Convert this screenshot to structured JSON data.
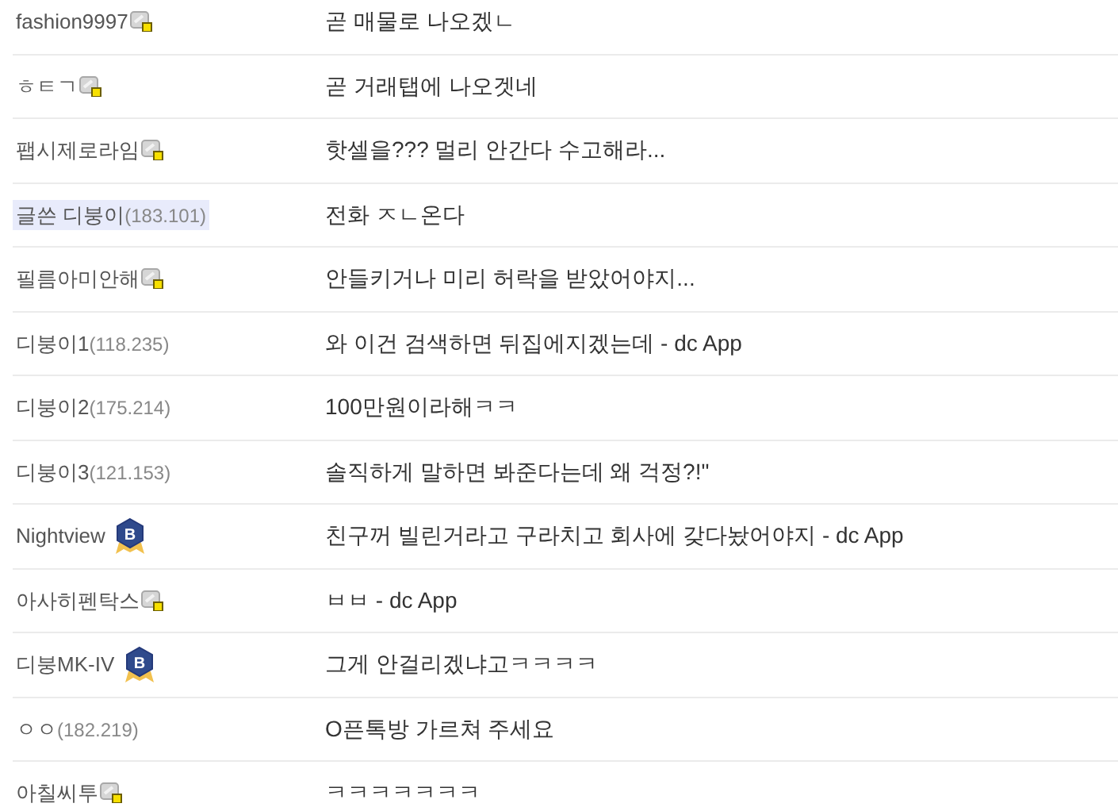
{
  "comments": [
    {
      "writer": {
        "name": "fashion9997",
        "kind": "fixed"
      },
      "author": false,
      "text": "곧 매물로 나오겠ㄴ"
    },
    {
      "writer": {
        "name": "ㅎㅌㄱ",
        "kind": "fixed"
      },
      "author": false,
      "text": "곧 거래탭에 나오겟네"
    },
    {
      "writer": {
        "name": "팹시제로라임",
        "kind": "fixed"
      },
      "author": false,
      "text": "핫셀을??? 멀리 안간다 수고해라..."
    },
    {
      "writer": {
        "name": "글쓴 디붕이",
        "kind": "guest",
        "ip": "(183.101)"
      },
      "author": true,
      "text": "전화 ㅈㄴ온다"
    },
    {
      "writer": {
        "name": "필름아미안해",
        "kind": "fixed"
      },
      "author": false,
      "text": "안들키거나 미리 허락을 받았어야지..."
    },
    {
      "writer": {
        "name": "디붕이1",
        "kind": "guest",
        "ip": "(118.235)"
      },
      "author": false,
      "text": "와 이건 검색하면 뒤집에지겠는데 - dc App"
    },
    {
      "writer": {
        "name": "디붕이2",
        "kind": "guest",
        "ip": "(175.214)"
      },
      "author": false,
      "text": "100만원이라해ㅋㅋ"
    },
    {
      "writer": {
        "name": "디붕이3",
        "kind": "guest",
        "ip": "(121.153)"
      },
      "author": false,
      "text": "솔직하게 말하면 봐준다는데 왜 걱정?!\""
    },
    {
      "writer": {
        "name": "Nightview",
        "kind": "badge",
        "badge": "B"
      },
      "author": false,
      "text": "친구꺼 빌린거라고 구라치고 회사에 갖다놨어야지 - dc App"
    },
    {
      "writer": {
        "name": "아사히펜탁스",
        "kind": "fixed"
      },
      "author": false,
      "text": "ㅂㅂ - dc App"
    },
    {
      "writer": {
        "name": "디붕MK-IV",
        "kind": "badge",
        "badge": "B"
      },
      "author": false,
      "text": "그게 안걸리겠냐고ㅋㅋㅋㅋ"
    },
    {
      "writer": {
        "name": "ㅇㅇ",
        "kind": "guest",
        "ip": "(182.219)"
      },
      "author": false,
      "text": "O픈톡방 가르쳐 주세요"
    },
    {
      "writer": {
        "name": "아칠씨투",
        "kind": "fixed"
      },
      "author": false,
      "text": "ㅋㅋㅋㅋㅋㅋㅋ"
    }
  ]
}
